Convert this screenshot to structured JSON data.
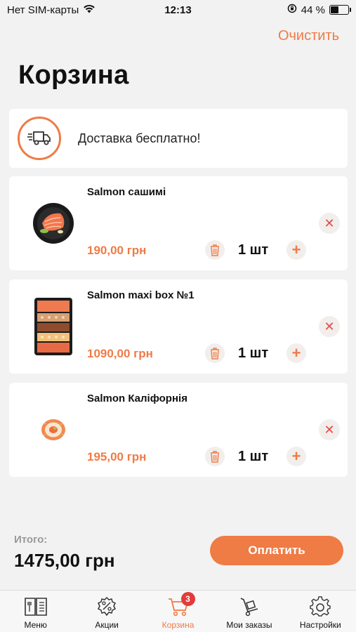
{
  "status": {
    "carrier": "Нет SIM-карты",
    "time": "12:13",
    "battery": "44 %",
    "battery_level": 0.44
  },
  "header": {
    "clear_label": "Очистить",
    "title": "Корзина"
  },
  "delivery": {
    "text": "Доставка бесплатно!",
    "icon": "delivery-truck-icon"
  },
  "items": [
    {
      "name": "Salmon сашимі",
      "price": "190,00 грн",
      "qty": "1 шт"
    },
    {
      "name": "Salmon maxi box №1",
      "price": "1090,00 грн",
      "qty": "1 шт"
    },
    {
      "name": "Salmon Каліфорнія",
      "price": "195,00 грн",
      "qty": "1 шт"
    }
  ],
  "total": {
    "label": "Итого:",
    "value": "1475,00 грн"
  },
  "pay_label": "Оплатить",
  "tabs": [
    {
      "label": "Меню",
      "icon": "menu-book-icon"
    },
    {
      "label": "Акции",
      "icon": "discount-gear-icon"
    },
    {
      "label": "Корзина",
      "icon": "cart-icon",
      "badge": "3",
      "active": true
    },
    {
      "label": "Мои заказы",
      "icon": "hand-truck-icon"
    },
    {
      "label": "Настройки",
      "icon": "settings-gear-icon"
    }
  ],
  "colors": {
    "accent": "#ef7b45",
    "background": "#f2f2f2",
    "badge": "#e33b3b"
  }
}
